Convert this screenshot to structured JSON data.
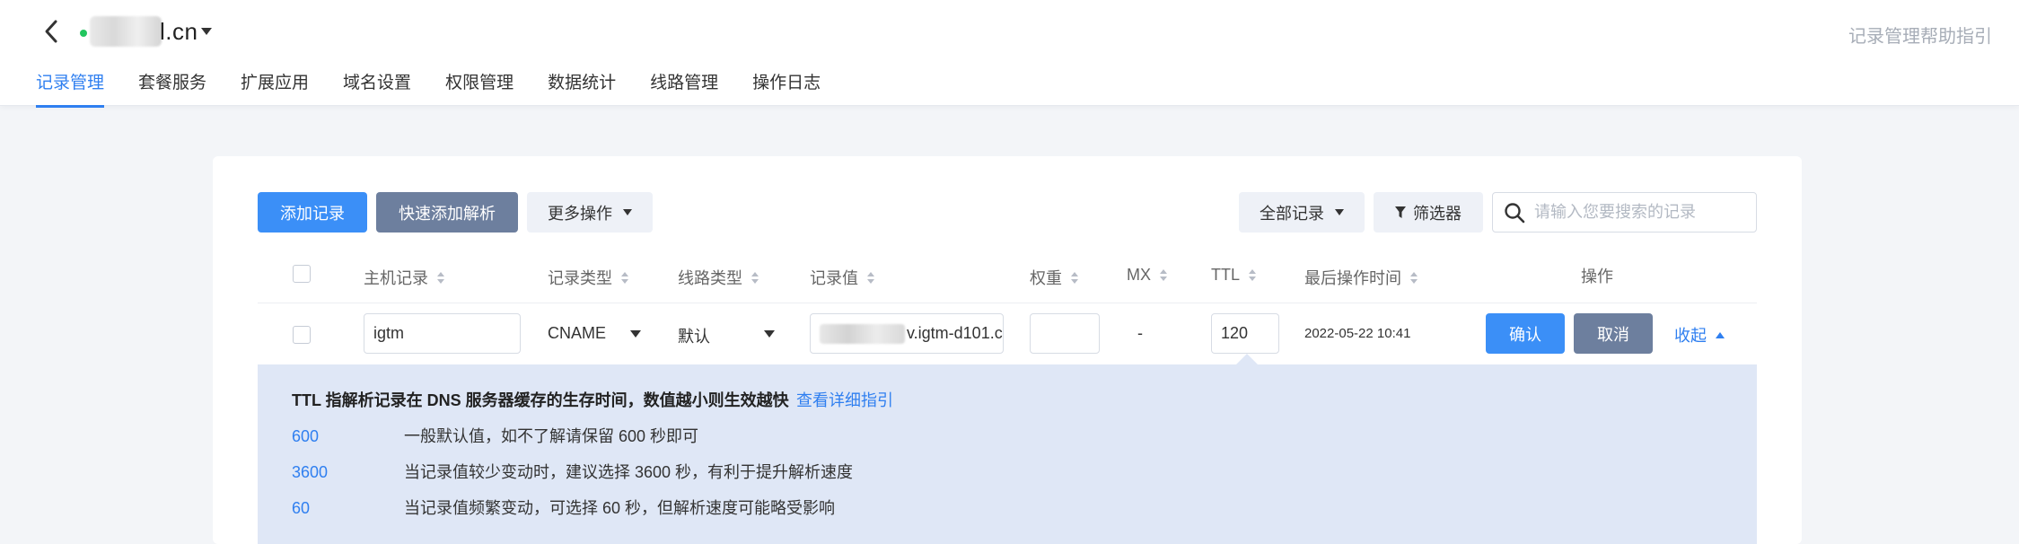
{
  "header": {
    "domain_suffix": "l.cn",
    "help_link": "记录管理帮助指引"
  },
  "tabs": [
    {
      "label": "记录管理",
      "active": true
    },
    {
      "label": "套餐服务"
    },
    {
      "label": "扩展应用"
    },
    {
      "label": "域名设置"
    },
    {
      "label": "权限管理"
    },
    {
      "label": "数据统计"
    },
    {
      "label": "线路管理"
    },
    {
      "label": "操作日志"
    }
  ],
  "toolbar": {
    "add_record": "添加记录",
    "quick_add": "快速添加解析",
    "more_ops": "更多操作",
    "all_records": "全部记录",
    "filter": "筛选器",
    "search_placeholder": "请输入您要搜索的记录"
  },
  "columns": {
    "host": "主机记录",
    "type": "记录类型",
    "line": "线路类型",
    "value": "记录值",
    "weight": "权重",
    "mx": "MX",
    "ttl": "TTL",
    "last_op": "最后操作时间",
    "actions": "操作"
  },
  "edit_row": {
    "host": "igtm",
    "type": "CNAME",
    "line": "默认",
    "value_suffix": "v.igtm-d101.c",
    "weight": "",
    "mx": "-",
    "ttl": "120",
    "last_op": "2022-05-22 10:41",
    "confirm": "确认",
    "cancel": "取消",
    "collapse": "收起"
  },
  "ttl_tip": {
    "title": "TTL 指解析记录在 DNS 服务器缓存的生存时间，数值越小则生效越快",
    "link": "查看详细指引",
    "options": [
      {
        "value": "600",
        "desc": "一般默认值，如不了解请保留 600 秒即可"
      },
      {
        "value": "3600",
        "desc": "当记录值较少变动时，建议选择 3600 秒，有利于提升解析速度"
      },
      {
        "value": "60",
        "desc": "当记录值频繁变动，可选择 60 秒，但解析速度可能略受影响"
      }
    ]
  },
  "colors": {
    "accent": "#2f7ff0",
    "primary_button": "#3b8ff7",
    "slate_button": "#6d7f9e",
    "tip_background": "#dfe7f6",
    "status_dot": "#22c55e"
  }
}
